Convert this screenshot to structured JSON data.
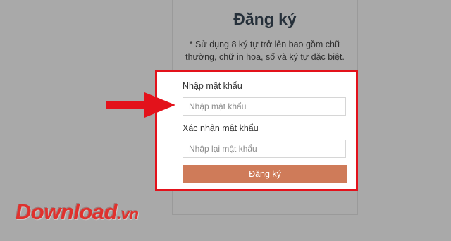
{
  "signup": {
    "title": "Đăng ký",
    "note": "* Sử dụng 8 ký tự trở lên bao gồm chữ thường, chữ in hoa, số và ký tự đặc biệt.",
    "password_label": "Nhập mật khẩu",
    "password_placeholder": "Nhập mật khẩu",
    "confirm_label": "Xác nhận mật khẩu",
    "confirm_placeholder": "Nhập lại mật khẩu",
    "submit_label": "Đăng ký"
  },
  "annotation": {
    "highlight_color": "#e3121b",
    "arrow_icon": "arrow-right-icon"
  },
  "watermark": {
    "name": "Download",
    "suffix": ".vn"
  },
  "colors": {
    "button": "#cf7b59",
    "overlay": "#a9a9a9",
    "watermark": "#e0312d"
  }
}
